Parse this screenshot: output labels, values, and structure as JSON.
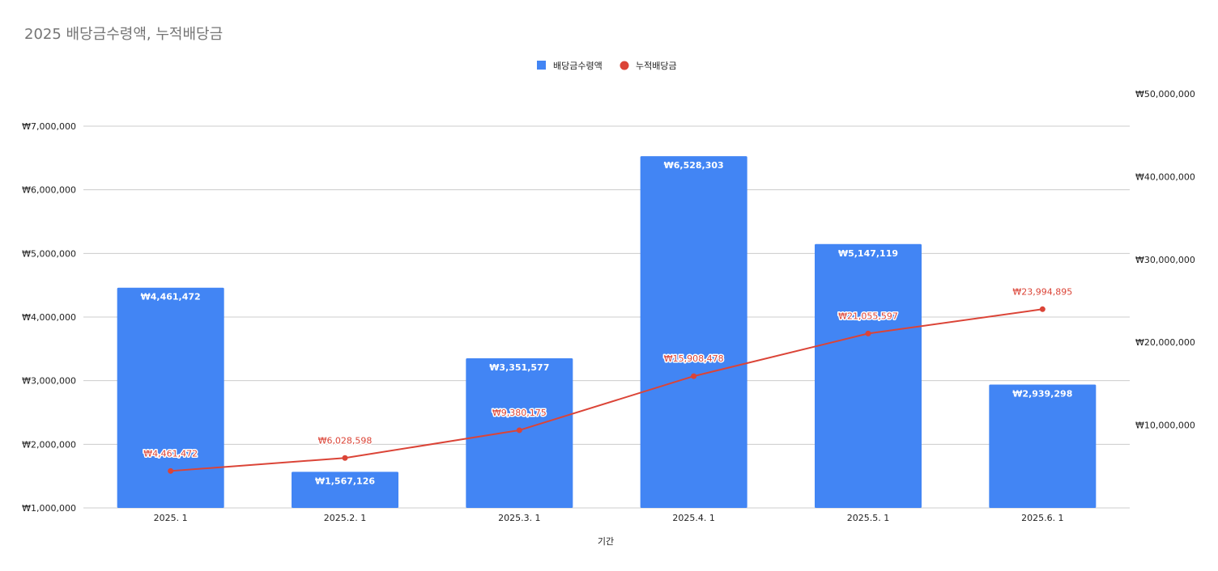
{
  "chart_data": {
    "type": "bar",
    "title": "2025 배당금수령액, 누적배당금",
    "xlabel": "기간",
    "categories": [
      "2025. 1",
      "2025.2. 1",
      "2025.3. 1",
      "2025.4. 1",
      "2025.5. 1",
      "2025.6. 1"
    ],
    "series": [
      {
        "name": "배당금수령액",
        "type": "bar",
        "axis": "left",
        "color": "#4285f4",
        "values": [
          4461472,
          1567126,
          3351577,
          6528303,
          5147119,
          2939298
        ],
        "labels": [
          "₩4,461,472",
          "₩1,567,126",
          "₩3,351,577",
          "₩6,528,303",
          "₩5,147,119",
          "₩2,939,298"
        ]
      },
      {
        "name": "누적배당금",
        "type": "line",
        "axis": "right",
        "color": "#db4437",
        "values": [
          4461472,
          6028598,
          9380175,
          15908478,
          21055597,
          23994895
        ],
        "labels": [
          "₩4,461,472",
          "₩6,028,598",
          "₩9,380,175",
          "₩15,908,478",
          "₩21,055,597",
          "₩23,994,895"
        ]
      }
    ],
    "y_left": {
      "range": [
        1000000,
        7000000
      ],
      "ticks": [
        1000000,
        2000000,
        3000000,
        4000000,
        5000000,
        6000000,
        7000000
      ],
      "tick_labels": [
        "₩1,000,000",
        "₩2,000,000",
        "₩3,000,000",
        "₩4,000,000",
        "₩5,000,000",
        "₩6,000,000",
        "₩7,000,000"
      ]
    },
    "y_right": {
      "range": [
        0,
        50000000
      ],
      "ticks": [
        10000000,
        20000000,
        30000000,
        40000000,
        50000000
      ],
      "tick_labels": [
        "₩10,000,000",
        "₩20,000,000",
        "₩30,000,000",
        "₩40,000,000",
        "₩50,000,000"
      ]
    },
    "grid": true,
    "legend_position": "top-center"
  }
}
